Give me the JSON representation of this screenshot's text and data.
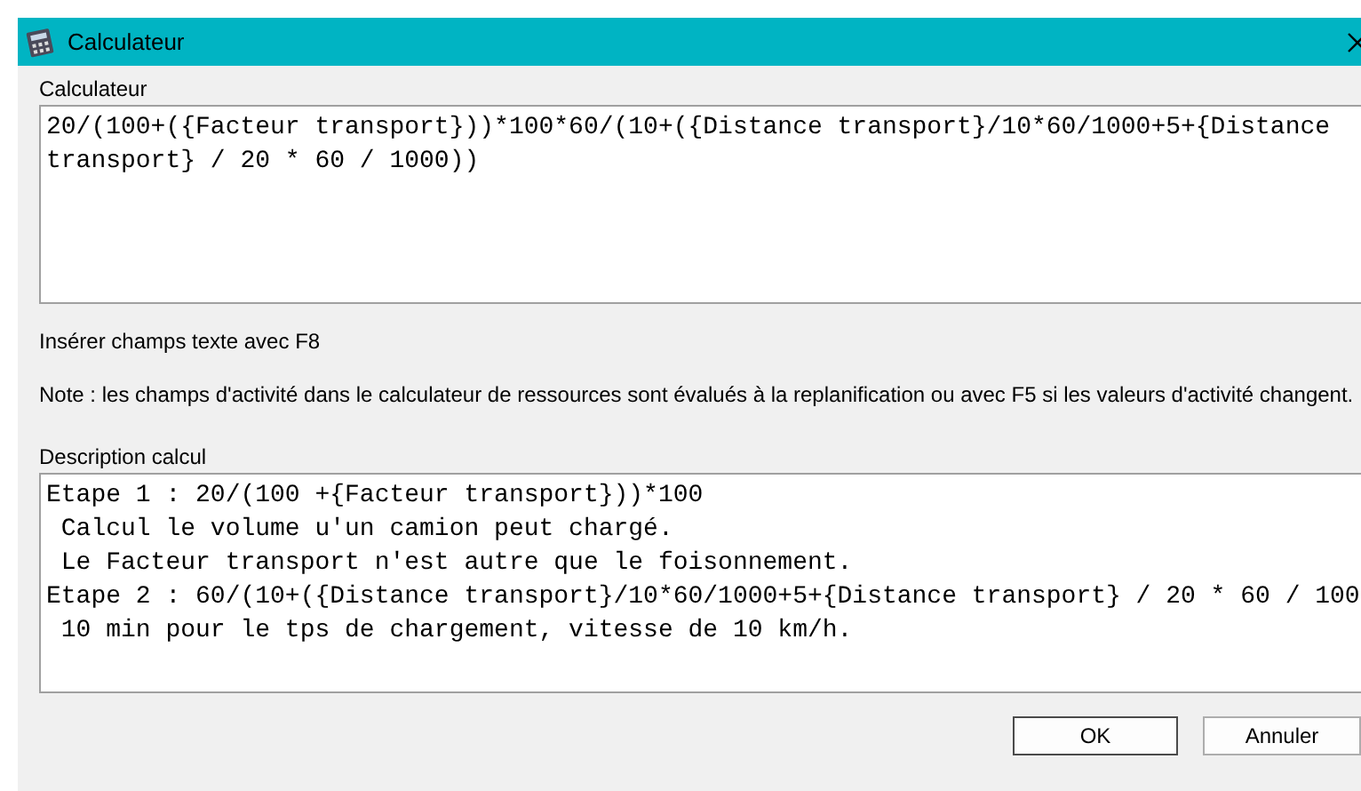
{
  "window": {
    "title": "Calculateur"
  },
  "formula": {
    "label": "Calculateur",
    "value": "20/(100+({Facteur transport}))*100*60/(10+({Distance transport}/10*60/1000+5+{Distance transport} / 20 * 60 / 1000))"
  },
  "hint": "Insérer champs texte avec F8",
  "note": "Note : les champs d'activité dans le calculateur de ressources sont évalués à la replanification ou avec F5 si les valeurs d'activité changent.",
  "description": {
    "label": "Description calcul",
    "lines": [
      "Etape 1 : 20/(100 +{Facteur transport}))*100",
      " Calcul le volume u'un camion peut chargé.",
      " Le Facteur transport n'est autre que le foisonnement.",
      "Etape 2 : 60/(10+({Distance transport}/10*60/1000+5+{Distance transport} / 20 * 60 / 100",
      " 10 min pour le tps de chargement, vitesse de 10 km/h."
    ]
  },
  "buttons": [
    {
      "label": "OK",
      "default": true
    },
    {
      "label": "Annuler",
      "default": false
    }
  ]
}
